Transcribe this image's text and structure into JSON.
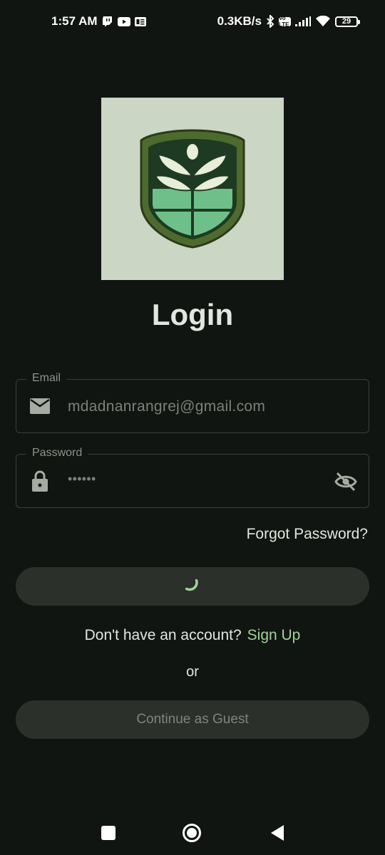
{
  "status_bar": {
    "time": "1:57 AM",
    "net_speed": "0.3KB/s",
    "battery": "29",
    "volte": "Vo LTE"
  },
  "title": "Login",
  "email": {
    "label": "Email",
    "value": "mdadnanrangrej@gmail.com"
  },
  "password": {
    "label": "Password",
    "value": "••••••"
  },
  "forgot_password": "Forgot Password?",
  "signup": {
    "prompt": "Don't have an account?",
    "link": "Sign Up"
  },
  "or": "or",
  "guest_button": "Continue as Guest",
  "colors": {
    "background": "#111511",
    "accent": "#9fd49a",
    "button": "#2b302a",
    "logo_bg": "#cbd6c5"
  }
}
